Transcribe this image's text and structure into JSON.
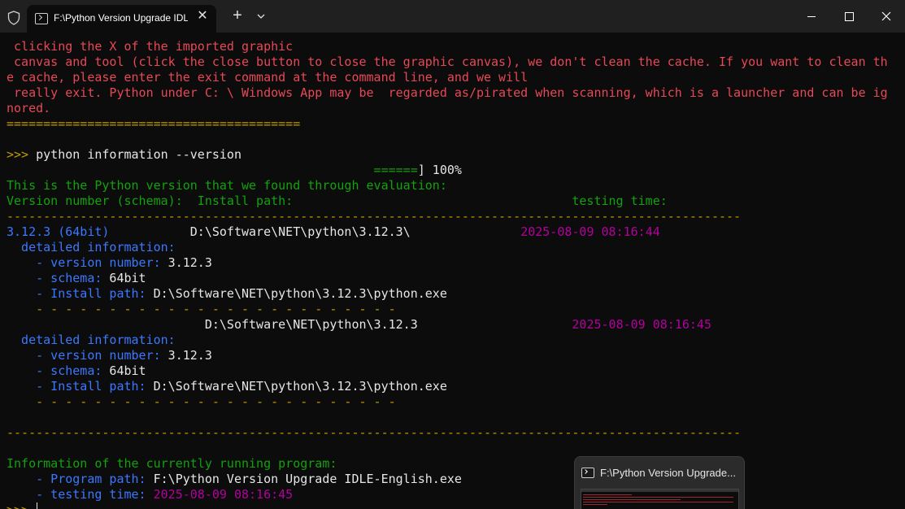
{
  "titlebar": {
    "tab_title": "F:\\Python Version Upgrade IDLE-English.exe",
    "close_tab_glyph": "✕",
    "new_tab_glyph": "+"
  },
  "terminal": {
    "intro": [
      " clicking the X of the imported graphic",
      " canvas and tool (click the close button to close the graphic canvas), we don't clean the cache. If you want to clean th",
      "e cache, please enter the exit command at the command line, and we will",
      " really exit. Python under C: \\ Windows App may be  regarded as/pirated when scanning, which is a launcher and can be ig",
      "nored."
    ],
    "separator_eq": "========================================",
    "prompt": ">>>",
    "command": " python information --version",
    "progress_pad": "                                                  ",
    "progress_bar": "======",
    "progress_text": "] 100%",
    "found_msg": "This is the Python version that we found through evaluation:",
    "header": "Version number (schema):  Install path:                                      testing time:",
    "separator_dash": "----------------------------------------------------------------------------------------------------",
    "entries": [
      {
        "version_label": "3.12.3 (64bit)",
        "gap": "           ",
        "path": "D:\\Software\\NET\\python\\3.12.3\\",
        "gap2": "               ",
        "time": "2025-08-09 08:16:44",
        "detail_label": "  detailed information:",
        "version_key": "    - version number:",
        "version_val": " 3.12.3",
        "schema_key": "    - schema:",
        "schema_val": " 64bit",
        "install_key": "    - Install path:",
        "install_val": " D:\\Software\\NET\\python\\3.12.3\\python.exe"
      },
      {
        "version_label": "",
        "gap": "                           ",
        "path": "D:\\Software\\NET\\python\\3.12.3",
        "gap2": "                     ",
        "time": "2025-08-09 08:16:45",
        "detail_label": "  detailed information:",
        "version_key": "    - version number:",
        "version_val": " 3.12.3",
        "schema_key": "    - schema:",
        "schema_val": " 64bit",
        "install_key": "    - Install path:",
        "install_val": " D:\\Software\\NET\\python\\3.12.3\\python.exe"
      }
    ],
    "sub_separator": "    - - - - - - - - - - - - - - - - - - - - - - - - -",
    "running_msg": "Information of the currently running program:",
    "program_key": "    - Program path:",
    "program_val": " F:\\Python Version Upgrade IDLE-English.exe",
    "testing_key": "    - testing time:",
    "testing_val": " 2025-08-09 08:16:45",
    "final_prompt": ">>> "
  },
  "preview": {
    "title": "F:\\Python Version Upgrade..."
  },
  "colors": {
    "background": "#0c0c0c",
    "red": "#e74856",
    "yellow": "#c19c00",
    "green": "#13a10e",
    "blue": "#3b78ff",
    "magenta": "#b4009e"
  }
}
